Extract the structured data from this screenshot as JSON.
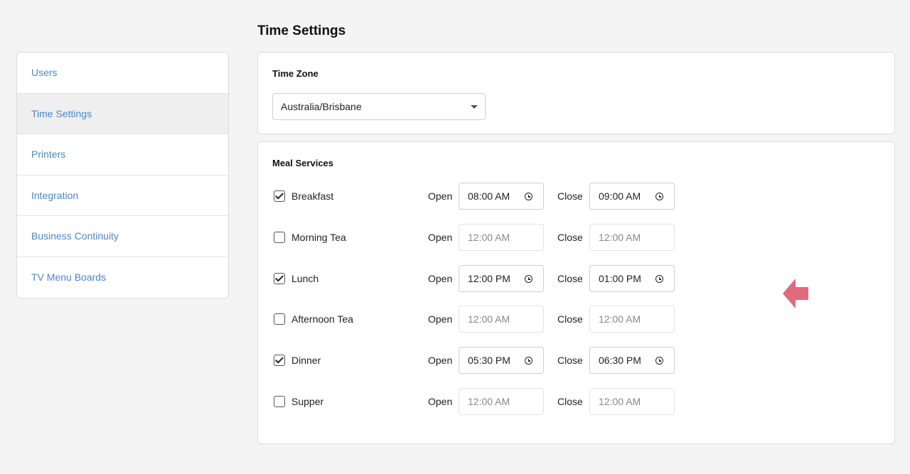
{
  "sidebar": {
    "items": [
      {
        "label": "Users"
      },
      {
        "label": "Time Settings"
      },
      {
        "label": "Printers"
      },
      {
        "label": "Integration"
      },
      {
        "label": "Business Continuity"
      },
      {
        "label": "TV Menu Boards"
      }
    ],
    "active": "Time Settings"
  },
  "page": {
    "title": "Time Settings"
  },
  "timezone": {
    "title": "Time Zone",
    "value": "Australia/Brisbane"
  },
  "meals": {
    "title": "Meal Services",
    "open_label": "Open",
    "close_label": "Close",
    "items": [
      {
        "name": "Breakfast",
        "enabled": true,
        "open": "08:00 AM",
        "close": "09:00 AM"
      },
      {
        "name": "Morning Tea",
        "enabled": false,
        "open": "12:00 AM",
        "close": "12:00 AM"
      },
      {
        "name": "Lunch",
        "enabled": true,
        "open": "12:00 PM",
        "close": "01:00 PM"
      },
      {
        "name": "Afternoon Tea",
        "enabled": false,
        "open": "12:00 AM",
        "close": "12:00 AM"
      },
      {
        "name": "Dinner",
        "enabled": true,
        "open": "05:30 PM",
        "close": "06:30 PM"
      },
      {
        "name": "Supper",
        "enabled": false,
        "open": "12:00 AM",
        "close": "12:00 AM"
      }
    ]
  },
  "colors": {
    "link": "#4a86c8",
    "arrow": "#e06a7e"
  },
  "icons": {
    "clock": "clock-icon",
    "dropdown": "chevron-down-icon",
    "pointer": "arrow-left-icon"
  }
}
